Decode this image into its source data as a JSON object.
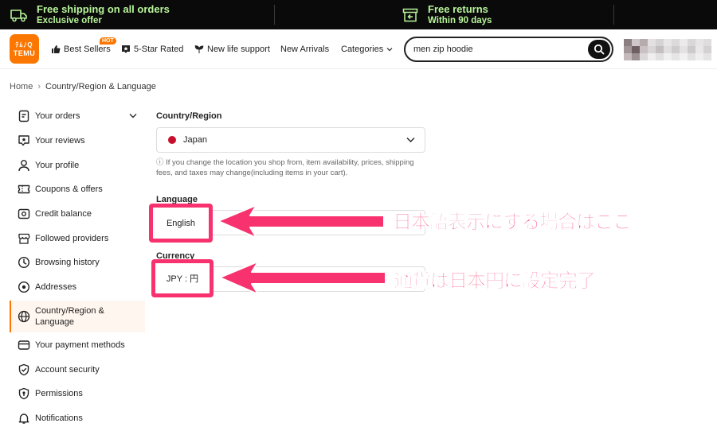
{
  "promo": {
    "shipping_title": "Free shipping on all orders",
    "shipping_sub": "Exclusive offer",
    "returns_title": "Free returns",
    "returns_sub": "Within 90 days",
    "accent": "#b8f59a"
  },
  "header": {
    "logo_line1": "ﾃﾑﾉQ",
    "logo_line2": "TEMU",
    "nav": {
      "best_sellers": "Best Sellers",
      "hot_badge": "HOT",
      "five_star": "5-Star Rated",
      "new_life": "New life support",
      "new_arrivals": "New Arrivals",
      "categories": "Categories"
    },
    "search_value": "men zip hoodie",
    "brand_color": "#fb7701"
  },
  "breadcrumb": {
    "home": "Home",
    "separator": "›",
    "current": "Country/Region & Language"
  },
  "sidebar": {
    "items": [
      {
        "label": "Your orders",
        "icon": "orders-icon"
      },
      {
        "label": "Your reviews",
        "icon": "reviews-icon"
      },
      {
        "label": "Your profile",
        "icon": "profile-icon"
      },
      {
        "label": "Coupons & offers",
        "icon": "coupon-icon"
      },
      {
        "label": "Credit balance",
        "icon": "credit-icon"
      },
      {
        "label": "Followed providers",
        "icon": "store-icon"
      },
      {
        "label": "Browsing history",
        "icon": "clock-icon"
      },
      {
        "label": "Addresses",
        "icon": "location-icon"
      },
      {
        "label": "Country/Region & Language",
        "icon": "globe-icon",
        "active": true
      },
      {
        "label": "Your payment methods",
        "icon": "card-icon"
      },
      {
        "label": "Account security",
        "icon": "shield-icon"
      },
      {
        "label": "Permissions",
        "icon": "permissions-icon"
      },
      {
        "label": "Notifications",
        "icon": "bell-icon"
      }
    ]
  },
  "content": {
    "country_label": "Country/Region",
    "country_value": "Japan",
    "notice": "ⓘ If you change the location you shop from, item availability, prices, shipping fees, and taxes may change(including items in your cart).",
    "language_label": "Language",
    "language_value": "English",
    "currency_label": "Currency",
    "currency_value": "JPY : 円"
  },
  "annotations": {
    "language_note": "日本語表示にする場合はここ",
    "currency_note": "通貨は日本円に設定完了",
    "color": "#f7326e"
  }
}
